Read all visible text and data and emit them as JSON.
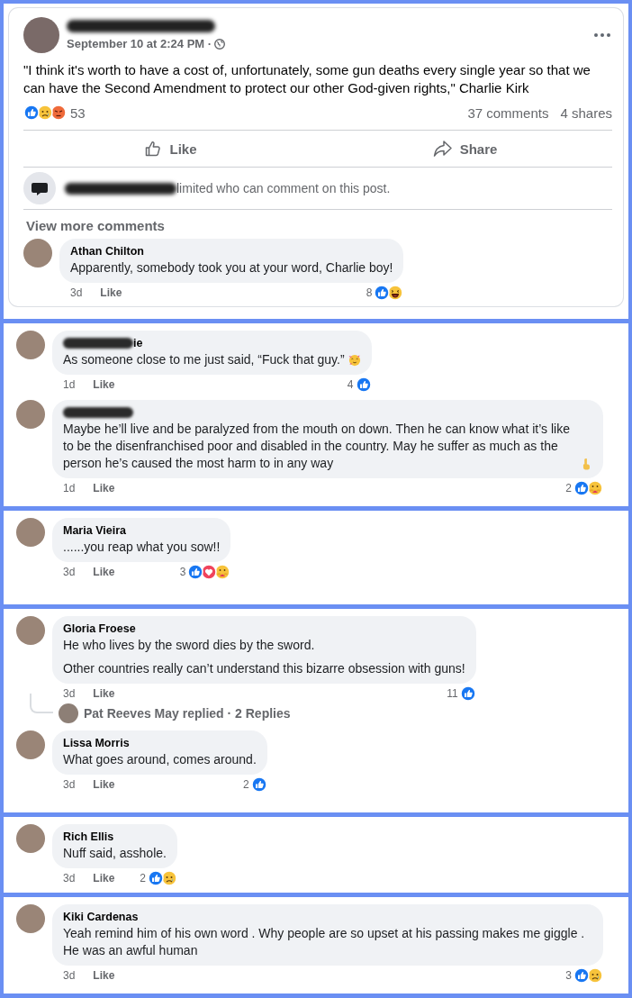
{
  "panels": [
    {
      "kind": "post",
      "post": {
        "author": {
          "redacted": true
        },
        "timestamp": "September 10 at 2:24 PM ·",
        "text": "\"I think it's worth to have a cost of, unfortunately, some gun deaths every single year so that we can have the Second Amendment to protect our other God-given rights,\" Charlie Kirk",
        "reactions": [
          {
            "kind": "like"
          },
          {
            "kind": "sad"
          },
          {
            "kind": "angry"
          }
        ],
        "reaction_count": "53",
        "comments_count": "37 comments",
        "shares_count": "4 shares",
        "actions": [
          {
            "kind": "like",
            "label": "Like"
          },
          {
            "kind": "share",
            "label": "Share"
          }
        ],
        "notice": "limited who can comment on this post.",
        "view_more": "View more comments"
      },
      "comments": [
        {
          "author": {
            "name": "Athan Chilton",
            "redacted": false
          },
          "paragraphs": [
            "Apparently, somebody took you at your word, Charlie boy!"
          ],
          "time": "3d",
          "like_label": "Like",
          "reaction_count": "8",
          "reactions": [
            {
              "kind": "like"
            },
            {
              "kind": "haha"
            }
          ]
        }
      ]
    },
    {
      "kind": "comments",
      "comments": [
        {
          "author": {
            "name": "ie",
            "redacted": true
          },
          "paragraphs": [
            "As someone close to me just said, “Fuck that guy.”"
          ],
          "emoji": {
            "kind": "party"
          },
          "time": "1d",
          "like_label": "Like",
          "reaction_count": "4",
          "reactions": [
            {
              "kind": "like"
            }
          ]
        },
        {
          "author": {
            "redacted": true
          },
          "paragraphs": [
            "Maybe he’ll live and be paralyzed from the mouth on down. Then he can know what it’s like to be the disenfranchised poor and disabled in the country. May he suffer as much as the person he’s caused the most harm to in any way"
          ],
          "emoji": {
            "kind": "finger"
          },
          "time": "1d",
          "like_label": "Like",
          "reaction_count": "2",
          "reactions": [
            {
              "kind": "like"
            },
            {
              "kind": "care"
            }
          ]
        }
      ]
    },
    {
      "kind": "comments",
      "comments": [
        {
          "author": {
            "name": "Maria Vieira",
            "redacted": false
          },
          "paragraphs": [
            "......you reap what you sow!!"
          ],
          "time": "3d",
          "like_label": "Like",
          "reaction_count": "3",
          "reactions": [
            {
              "kind": "like"
            },
            {
              "kind": "love"
            },
            {
              "kind": "care"
            }
          ]
        }
      ]
    },
    {
      "kind": "comments",
      "comments": [
        {
          "author": {
            "name": "Gloria Froese",
            "redacted": false
          },
          "paragraphs": [
            "He who lives by the sword dies by the sword.",
            "Other countries really can’t understand this bizarre obsession with guns!"
          ],
          "time": "3d",
          "like_label": "Like",
          "reaction_count": "11",
          "reactions": [
            {
              "kind": "like"
            }
          ],
          "replies": "Pat Reeves May replied · 2 Replies"
        },
        {
          "author": {
            "name": "Lissa Morris",
            "redacted": false
          },
          "paragraphs": [
            "What goes around, comes around."
          ],
          "time": "3d",
          "like_label": "Like",
          "reaction_count": "2",
          "reactions": [
            {
              "kind": "like"
            }
          ]
        }
      ]
    },
    {
      "kind": "comments",
      "comments": [
        {
          "author": {
            "name": "Rich Ellis",
            "redacted": false
          },
          "paragraphs": [
            "Nuff said, asshole."
          ],
          "time": "3d",
          "like_label": "Like",
          "reaction_count": "2",
          "reactions": [
            {
              "kind": "like"
            },
            {
              "kind": "sad"
            }
          ]
        }
      ]
    },
    {
      "kind": "comments",
      "comments": [
        {
          "author": {
            "name": "Kiki Cardenas",
            "redacted": false
          },
          "paragraphs": [
            "Yeah remind him of his own word . Why people are so upset at his passing makes me giggle . He was an awful human"
          ],
          "time": "3d",
          "like_label": "Like",
          "reaction_count": "3",
          "reactions": [
            {
              "kind": "like"
            },
            {
              "kind": "sad"
            }
          ]
        }
      ]
    }
  ]
}
